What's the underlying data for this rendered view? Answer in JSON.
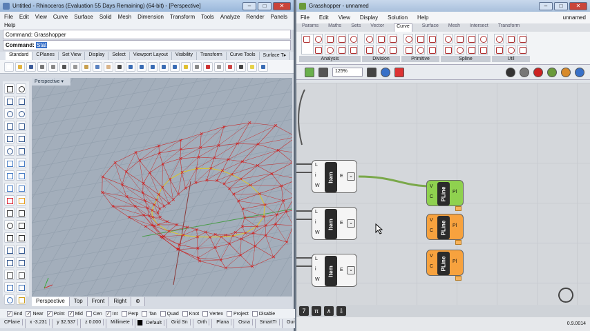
{
  "rhino": {
    "title": "Untitled - Rhinoceros (Evaluation 55 Days Remaining) (64-bit) - [Perspective]",
    "menu": [
      "File",
      "Edit",
      "View",
      "Curve",
      "Surface",
      "Solid",
      "Mesh",
      "Dimension",
      "Transform",
      "Tools",
      "Analyze",
      "Render",
      "Panels"
    ],
    "menu_help": "Help",
    "command_history": "Command: Grasshopper",
    "command_label": "Command:",
    "command_typed": "Stat",
    "toolbar_tabs": [
      "Standard",
      "CPlanes",
      "Set View",
      "Display",
      "Select",
      "Viewport Layout",
      "Visibility",
      "Transform",
      "Curve Tools",
      "Surface T▸"
    ],
    "viewport_title": "Perspective ▾",
    "viewport_tabs": [
      "Perspective",
      "Top",
      "Front",
      "Right",
      "⊕"
    ],
    "osnaps": [
      {
        "label": "End",
        "checked": true
      },
      {
        "label": "Near",
        "checked": true
      },
      {
        "label": "Point",
        "checked": true
      },
      {
        "label": "Mid",
        "checked": true
      },
      {
        "label": "Cen",
        "checked": false
      },
      {
        "label": "Int",
        "checked": true
      },
      {
        "label": "Perp",
        "checked": false
      },
      {
        "label": "Tan",
        "checked": false
      },
      {
        "label": "Quad",
        "checked": false
      },
      {
        "label": "Knot",
        "checked": false
      },
      {
        "label": "Vertex",
        "checked": false
      },
      {
        "label": "Project",
        "checked": false
      },
      {
        "label": "Disable",
        "checked": false
      }
    ],
    "status": [
      "CPlane",
      "x -3.231",
      "y 32.537",
      "z 0.000",
      "Millimete",
      "Default",
      "Grid Sn",
      "Orth",
      "Plana",
      "Osna",
      "SmartTr",
      "Gumb",
      "Record Hi",
      "Filter"
    ]
  },
  "gh": {
    "title": "Grasshopper - unnamed",
    "menu": [
      "File",
      "Edit",
      "View",
      "Display",
      "Solution",
      "Help"
    ],
    "doc_name": "unnamed",
    "tabs": [
      "Params",
      "Maths",
      "Sets",
      "Vector",
      "Curve",
      "Surface",
      "Mesh",
      "Intersect",
      "Transform"
    ],
    "ribbon_groups": [
      "Analysis",
      "Division",
      "Primitive",
      "Spline",
      "Util"
    ],
    "zoom": "125%",
    "components": [
      {
        "inputs": [
          "L",
          "i",
          "W"
        ],
        "name": "Item",
        "output": "E"
      },
      {
        "inputs": [
          "L",
          "i",
          "W"
        ],
        "name": "Item",
        "output": "E"
      },
      {
        "inputs": [
          "L",
          "i",
          "W"
        ],
        "name": "Item",
        "output": "E"
      }
    ],
    "plines": [
      {
        "inputs": [
          "V",
          "C"
        ],
        "name": "PLine",
        "output": "Pl",
        "state": "ok"
      },
      {
        "inputs": [
          "V",
          "C"
        ],
        "name": "PLine",
        "output": "Pl",
        "state": "warning"
      },
      {
        "inputs": [
          "V",
          "C"
        ],
        "name": "PLine",
        "output": "Pl",
        "state": "warning"
      }
    ],
    "version": "0.9.0014",
    "colors": {
      "ok": "#8fd14f",
      "warning": "#f7a23e",
      "selected": "#3870c8"
    }
  }
}
